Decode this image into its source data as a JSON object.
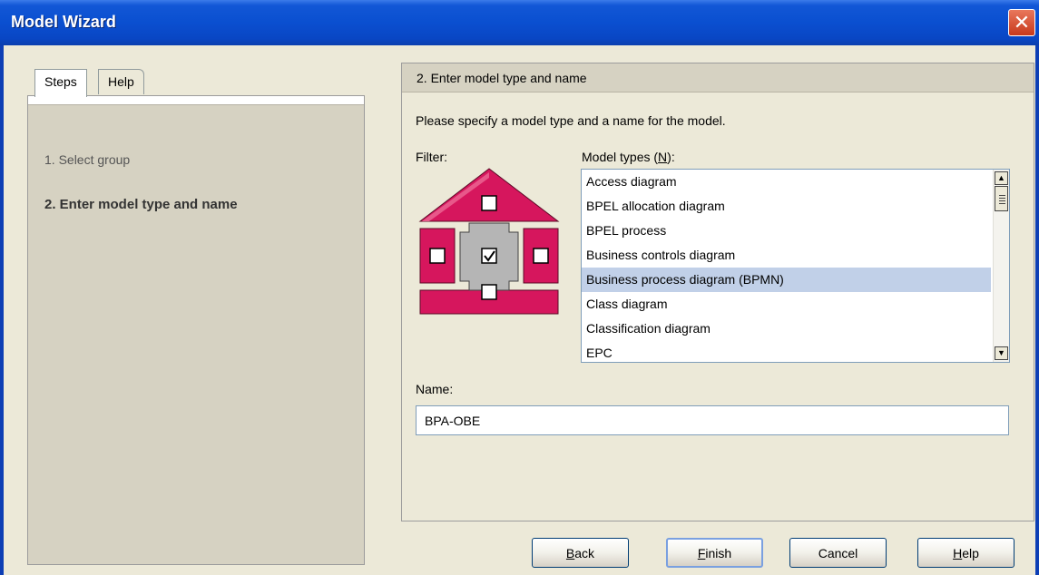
{
  "window": {
    "title": "Model Wizard",
    "close_glyph": "✕"
  },
  "tabs": {
    "steps_label": "Steps",
    "help_label": "Help"
  },
  "steps": [
    {
      "label": "1. Select group"
    },
    {
      "label": "2. Enter model type and name"
    }
  ],
  "main": {
    "header": "2. Enter model type and name",
    "description": "Please specify a model type and a name for the model.",
    "filter_label": "Filter:",
    "model_types_label_pre": "Model types (",
    "model_types_label_key": "N",
    "model_types_label_post": "):",
    "model_types": [
      "Access diagram",
      "BPEL allocation diagram",
      "BPEL process",
      "Business controls diagram",
      "Business process diagram (BPMN)",
      "Class diagram",
      "Classification diagram",
      "EPC"
    ],
    "selected_model_type": "Business process diagram (BPMN)",
    "name_label": "Name:",
    "name_value": "BPA-OBE"
  },
  "buttons": {
    "back_key": "B",
    "back_rest": "ack",
    "finish_key": "F",
    "finish_rest": "inish",
    "cancel": "Cancel",
    "help_key": "H",
    "help_rest": "elp"
  },
  "colors": {
    "filter_magenta": "#d6165d",
    "filter_gray": "#b5b5b5",
    "selected_row": "#c1d0e8"
  }
}
